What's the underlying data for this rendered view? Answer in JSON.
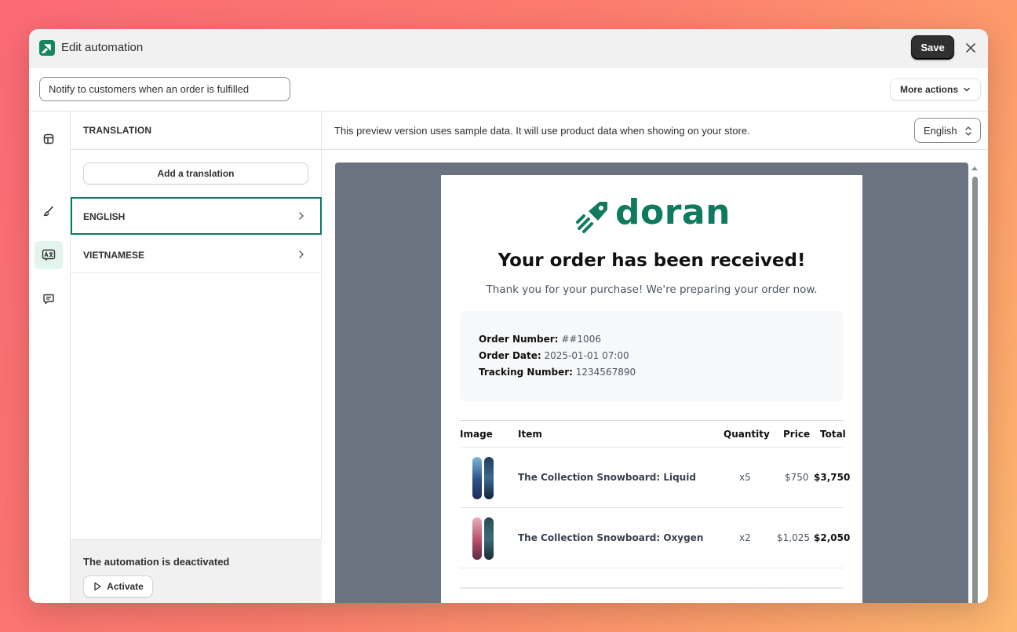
{
  "header": {
    "title": "Edit automation",
    "save_label": "Save"
  },
  "automation": {
    "name_value": "Notify to customers when an order is fulfilled",
    "more_actions_label": "More actions"
  },
  "translation_panel": {
    "heading": "TRANSLATION",
    "add_label": "Add a translation",
    "languages": [
      {
        "label": "ENGLISH",
        "active": true
      },
      {
        "label": "VIETNAMESE",
        "active": false
      }
    ],
    "status_text": "The automation is deactivated",
    "activate_label": "Activate"
  },
  "preview": {
    "note": "This preview version uses sample data. It will use product data when showing on your store.",
    "language_selected": "English"
  },
  "email": {
    "brand": "doran",
    "title": "Your order has been received!",
    "subtitle": "Thank you for your purchase! We're preparing your order now.",
    "order_number_label": "Order Number:",
    "order_number": "##1006",
    "order_date_label": "Order Date:",
    "order_date": "2025-01-01 07:00",
    "tracking_label": "Tracking Number:",
    "tracking_number": "1234567890",
    "columns": [
      "Image",
      "Item",
      "Quantity",
      "Price",
      "Total"
    ],
    "rows": [
      {
        "item": "The Collection Snowboard: Liquid",
        "qty": "x5",
        "price": "$750",
        "total": "$3,750"
      },
      {
        "item": "The Collection Snowboard: Oxygen",
        "qty": "x2",
        "price": "$1,025",
        "total": "$2,050"
      }
    ]
  },
  "colors": {
    "brand_green": "#0f7a5e",
    "active_border": "#0c7a61",
    "save_bg": "#303030"
  },
  "icons": {
    "rail": [
      "layout-icon",
      "brush-icon",
      "translate-icon",
      "chat-icon"
    ]
  }
}
